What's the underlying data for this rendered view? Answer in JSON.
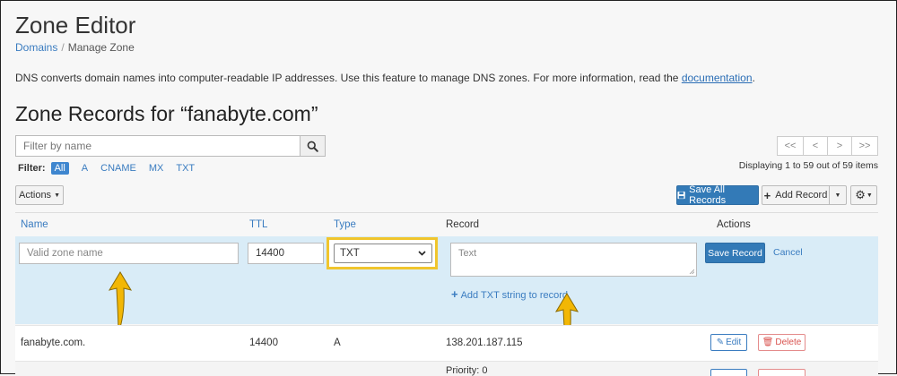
{
  "page": {
    "title": "Zone Editor",
    "breadcrumb": {
      "parent": "Domains",
      "separator": "/",
      "current": "Manage Zone"
    },
    "description": "DNS converts domain names into computer-readable IP addresses. Use this feature to manage DNS zones. For more information, read the ",
    "description_link": "documentation",
    "description_end": "."
  },
  "zone": {
    "heading": "Zone Records for “fanabyte.com”"
  },
  "search": {
    "placeholder": "Filter by name",
    "icon": "search-icon"
  },
  "filter": {
    "label": "Filter:",
    "options": [
      "All",
      "A",
      "CNAME",
      "MX",
      "TXT"
    ],
    "active": "All"
  },
  "pagination": {
    "buttons": [
      "<<",
      "<",
      ">",
      ">>"
    ],
    "summary": "Displaying 1 to 59 out of 59 items"
  },
  "toolbar": {
    "actions_label": "Actions",
    "save_all_label": "Save All Records",
    "add_record_label": "Add Record",
    "settings_icon": "gear-icon"
  },
  "table": {
    "columns": {
      "name": "Name",
      "ttl": "TTL",
      "type": "Type",
      "record": "Record",
      "actions": "Actions"
    }
  },
  "edit_row": {
    "name_placeholder": "Valid zone name",
    "ttl_value": "14400",
    "type_value": "TXT",
    "record_placeholder": "Text",
    "add_txt_label": "Add TXT string to record",
    "save_label": "Save Record",
    "cancel_label": "Cancel"
  },
  "rows": [
    {
      "name": "fanabyte.com.",
      "ttl": "14400",
      "type": "A",
      "record": "138.201.187.115",
      "edit_label": "Edit",
      "delete_label": "Delete"
    }
  ],
  "partial_row": {
    "record": "Priority: 0"
  },
  "colors": {
    "accent": "#337ab7",
    "link": "#3a7cc0",
    "edit_row_bg": "#d9ecf7",
    "highlight": "#f0c52d",
    "arrow": "#f2b705",
    "delete": "#d9534f"
  }
}
